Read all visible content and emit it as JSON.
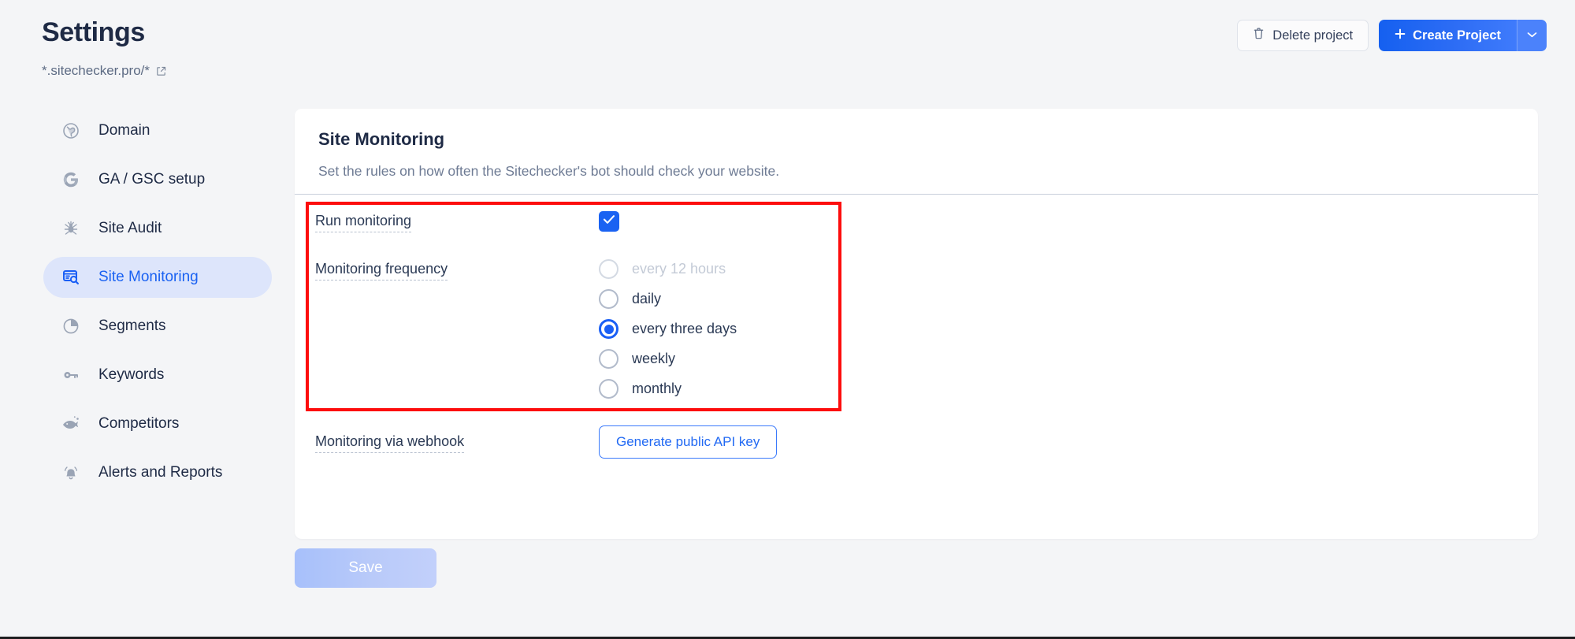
{
  "header": {
    "title": "Settings",
    "domain": "*.sitechecker.pro/*",
    "external_link_icon": "external-link-icon",
    "delete_label": "Delete project",
    "delete_icon": "trash-icon",
    "create_label": "Create Project",
    "create_plus_icon": "plus-icon",
    "create_caret_icon": "chevron-down-icon"
  },
  "sidebar": {
    "items": [
      {
        "label": "Domain",
        "icon": "globe-icon",
        "active": false
      },
      {
        "label": "GA / GSC setup",
        "icon": "google-g-icon",
        "active": false
      },
      {
        "label": "Site Audit",
        "icon": "spider-icon",
        "active": false
      },
      {
        "label": "Site Monitoring",
        "icon": "monitor-search-icon",
        "active": true
      },
      {
        "label": "Segments",
        "icon": "pie-chart-icon",
        "active": false
      },
      {
        "label": "Keywords",
        "icon": "key-icon",
        "active": false
      },
      {
        "label": "Competitors",
        "icon": "fish-icon",
        "active": false
      },
      {
        "label": "Alerts and Reports",
        "icon": "bell-icon",
        "active": false
      }
    ]
  },
  "card": {
    "title": "Site Monitoring",
    "subtitle": "Set the rules on how often the Sitechecker's bot should check your website."
  },
  "form": {
    "run_monitoring_label": "Run monitoring",
    "run_monitoring_checked": true,
    "checkbox_icon": "check-icon",
    "frequency_label": "Monitoring frequency",
    "frequency_options": [
      {
        "label": "every 12 hours",
        "selected": false,
        "disabled": true
      },
      {
        "label": "daily",
        "selected": false,
        "disabled": false
      },
      {
        "label": "every three days",
        "selected": true,
        "disabled": false
      },
      {
        "label": "weekly",
        "selected": false,
        "disabled": false
      },
      {
        "label": "monthly",
        "selected": false,
        "disabled": false
      }
    ],
    "webhook_label": "Monitoring via webhook",
    "api_key_button": "Generate public API key"
  },
  "footer": {
    "save_label": "Save",
    "save_disabled": true
  },
  "annotation": {
    "highlight_color": "#fd0d0d"
  },
  "colors": {
    "accent_blue": "#1a62f2",
    "sidebar_active_bg": "#dde5fb",
    "page_bg": "#f4f5f7",
    "text_dark": "#1e2a45",
    "text_muted": "#6e7b94"
  }
}
